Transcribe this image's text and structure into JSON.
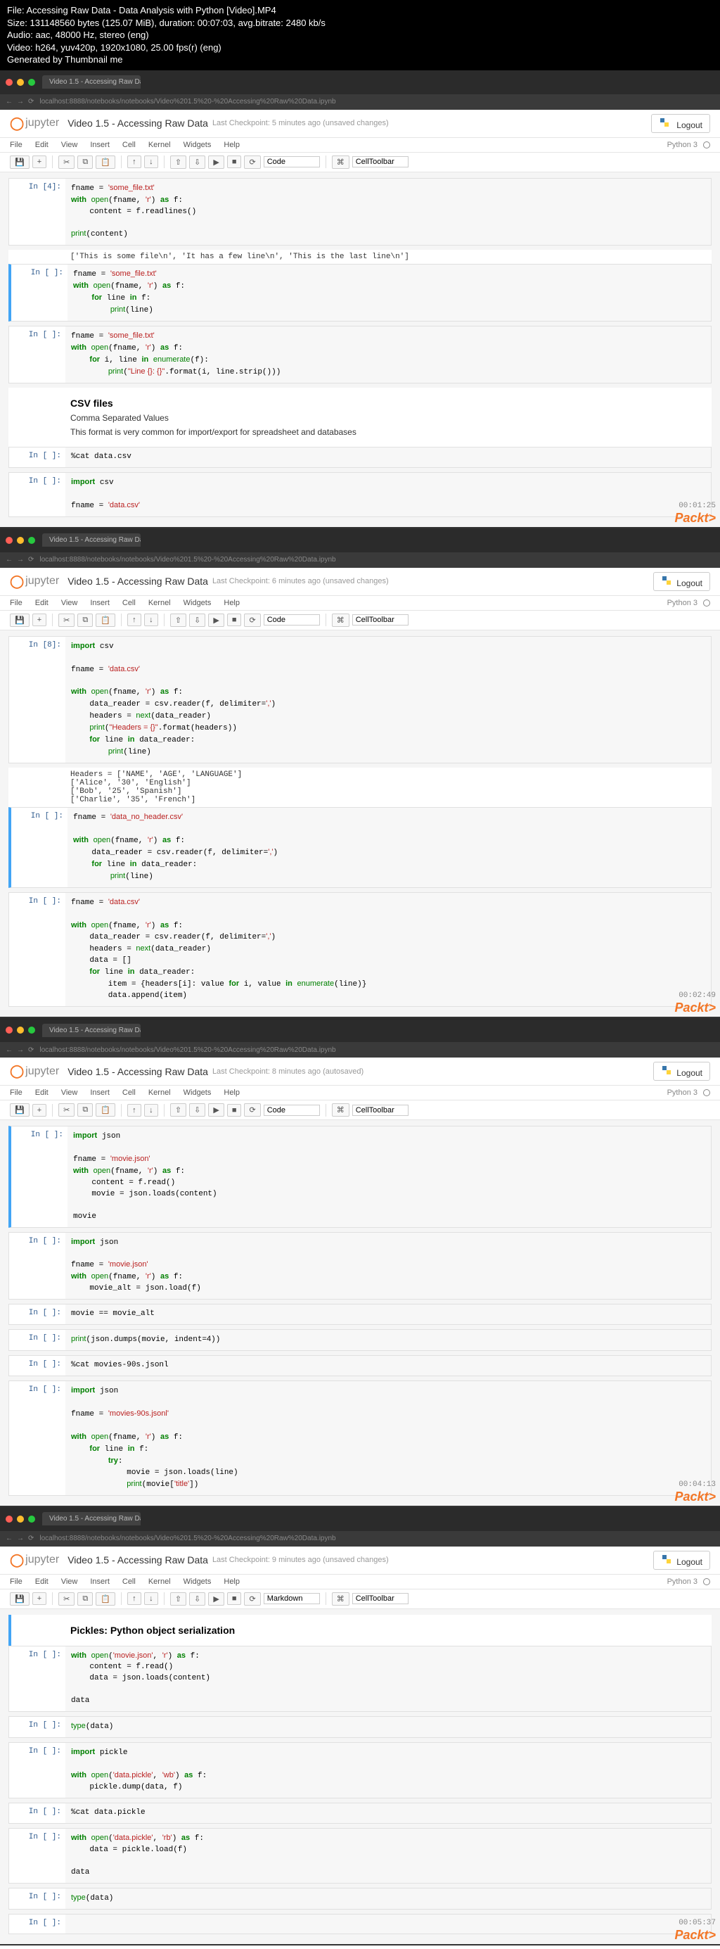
{
  "meta": {
    "file_line": "File: Accessing Raw Data - Data Analysis with Python [Video].MP4",
    "size_line": "Size: 131148560 bytes (125.07 MiB), duration: 00:07:03, avg.bitrate: 2480 kb/s",
    "audio_line": "Audio: aac, 48000 Hz, stereo (eng)",
    "video_line": "Video: h264, yuv420p, 1920x1080, 25.00 fps(r) (eng)",
    "gen_line": "Generated by Thumbnail me"
  },
  "browser": {
    "tab_title": "Video 1.5 - Accessing Raw Da",
    "url": "localhost:8888/notebooks/notebooks/Video%201.5%20-%20Accessing%20Raw%20Data.ipynb",
    "nav_back": "←",
    "nav_fwd": "→",
    "nav_reload": "⟳"
  },
  "jupyter": {
    "logo_text": "jupyter",
    "title": "Video 1.5 - Accessing Raw Data",
    "logout": "Logout",
    "kernel": "Python 3",
    "menus": [
      "File",
      "Edit",
      "View",
      "Insert",
      "Cell",
      "Kernel",
      "Widgets",
      "Help"
    ],
    "toolbar": {
      "save": "💾",
      "add": "+",
      "cut": "✂",
      "copy": "⧉",
      "paste": "📋",
      "up": "↑",
      "down": "↓",
      "runu": "⇧",
      "rund": "⇩",
      "run": "▶",
      "stop": "■",
      "restart": "⟳",
      "celltype_code": "Code",
      "celltype_md": "Markdown",
      "celltb": "CellToolbar",
      "cmd": "⌘"
    }
  },
  "sec1": {
    "checkpoint": "Last Checkpoint: 5 minutes ago (unsaved changes)",
    "timestamp": "00:01:25",
    "cells": {
      "c1_prompt": "In [4]:",
      "c1_out": "['This is some file\\n', 'It has a few line\\n', 'This is the last line\\n']",
      "c2_prompt": "In [ ]:",
      "c3_prompt": "In [ ]:",
      "md_h": "CSV files",
      "md_p1": "Comma Separated Values",
      "md_p2": "This format is very common for import/export for spreadsheet and databases",
      "c4_prompt": "In [ ]:",
      "c4_code": "%cat data.csv",
      "c5_prompt": "In [ ]:"
    }
  },
  "sec2": {
    "checkpoint": "Last Checkpoint: 6 minutes ago (unsaved changes)",
    "timestamp": "00:02:49",
    "c1_prompt": "In [8]:",
    "c1_out": "Headers = ['NAME', 'AGE', 'LANGUAGE']\n['Alice', '30', 'English']\n['Bob', '25', 'Spanish']\n['Charlie', '35', 'French']",
    "c2_prompt": "In [ ]:",
    "c3_prompt": "In [ ]:"
  },
  "sec3": {
    "checkpoint": "Last Checkpoint: 8 minutes ago (autosaved)",
    "timestamp": "00:04:13",
    "c1_prompt": "In [ ]:",
    "c2_prompt": "In [ ]:",
    "c3_prompt": "In [ ]:",
    "c3_code": "movie == movie_alt",
    "c4_prompt": "In [ ]:",
    "c5_prompt": "In [ ]:",
    "c5_code": "%cat movies-90s.jsonl",
    "c6_prompt": "In [ ]:"
  },
  "sec4": {
    "checkpoint": "Last Checkpoint: 9 minutes ago (unsaved changes)",
    "timestamp": "00:05:37",
    "md_h": "Pickles: Python object serialization",
    "c1_prompt": "In [ ]:",
    "c1p2": "data",
    "c2_prompt": "In [ ]:",
    "c3_prompt": "In [ ]:",
    "c4_prompt": "In [ ]:",
    "c4_code": "%cat data.pickle",
    "c5_prompt": "In [ ]:",
    "c5p2": "data",
    "c6_prompt": "In [ ]:",
    "c7_prompt": "In [ ]:"
  },
  "packt": "Packt>"
}
